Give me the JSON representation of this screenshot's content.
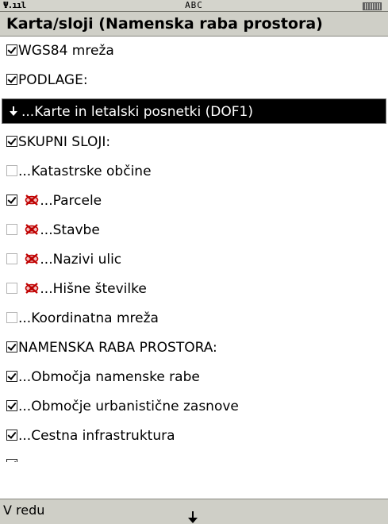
{
  "status": {
    "signal": "Ψ.ııl",
    "mode": "ABC",
    "battery_icon": "battery-icon"
  },
  "title": "Karta/sloji (Namenska raba prostora)",
  "items": [
    {
      "label": "WGS84 mreža",
      "checked": true
    },
    {
      "label": "PODLAGE:",
      "checked": true
    },
    {
      "label": "...Karte in letalski posnetki (DOF1)",
      "selected": true
    },
    {
      "label": "SKUPNI SLOJI:",
      "checked": true
    },
    {
      "label": "...Katastrske občine",
      "checked": false
    },
    {
      "label": "...Parcele",
      "checked": true,
      "hidden_icon": true
    },
    {
      "label": "...Stavbe",
      "checked": false,
      "hidden_icon": true
    },
    {
      "label": "...Nazivi ulic",
      "checked": false,
      "hidden_icon": true
    },
    {
      "label": "...Hišne številke",
      "checked": false,
      "hidden_icon": true
    },
    {
      "label": "...Koordinatna mreža",
      "checked": false
    },
    {
      "label": "NAMENSKA RABA PROSTORA:",
      "checked": true
    },
    {
      "label": "...Območja namenske rabe",
      "checked": true
    },
    {
      "label": "...Območje urbanistične zasnove",
      "checked": true
    },
    {
      "label": "...Cestna infrastruktura",
      "checked": true
    }
  ],
  "softkeys": {
    "left": "V redu"
  },
  "colors": {
    "selected_bg": "#000000",
    "bar_bg": "#cfcfc7",
    "hidden_icon": "#c00000"
  }
}
